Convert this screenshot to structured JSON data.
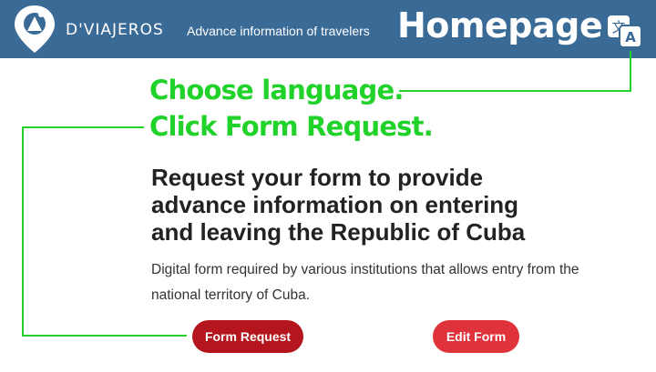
{
  "header": {
    "brand": "D'VIAJEROS",
    "tagline": "Advance information of travelers",
    "page_title": "Homepage"
  },
  "annotations": {
    "choose_language": "Choose language.",
    "click_form_request": "Click Form Request."
  },
  "main": {
    "heading": "Request your form to provide advance information on entering and leaving the Republic of Cuba",
    "description": "Digital form required by various institutions that allows entry from the national territory of Cuba.",
    "form_request_label": "Form Request",
    "edit_form_label": "Edit Form"
  },
  "colors": {
    "header_bg": "#3a6a96",
    "annotation_green": "#21d22a",
    "primary_button": "#b5151d",
    "secondary_button": "#e0323a"
  },
  "icons": {
    "logo": "location-pin-logo",
    "language": "translate-icon"
  }
}
